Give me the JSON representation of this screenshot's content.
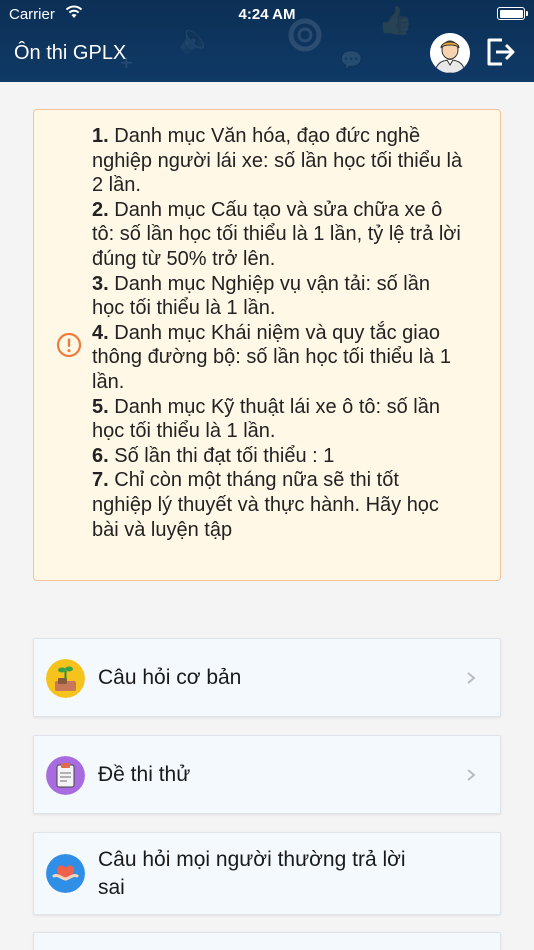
{
  "status_bar": {
    "carrier": "Carrier",
    "time": "4:24 AM"
  },
  "header": {
    "title": "Ôn thi GPLX"
  },
  "notice": {
    "items": [
      {
        "num": "1.",
        "text": " Danh mục Văn hóa, đạo đức nghề nghiệp người lái xe: số lần học tối thiểu là 2 lần."
      },
      {
        "num": "2.",
        "text": " Danh mục Cấu tạo và sửa chữa xe ô tô: số lần học tối thiểu là 1 lần, tỷ lệ trả lời đúng từ 50% trở lên."
      },
      {
        "num": "3.",
        "text": " Danh mục Nghiệp vụ vận tải: số lần học tối thiểu là 1 lần."
      },
      {
        "num": "4.",
        "text": " Danh mục Khái niệm và quy tắc giao thông đường bộ: số lần học tối thiểu là 1 lần."
      },
      {
        "num": "5.",
        "text": " Danh mục Kỹ thuật lái xe ô tô: số lần học tối thiểu là 1 lần."
      },
      {
        "num": "6.",
        "text": " Số lần thi đạt tối thiểu : 1"
      },
      {
        "num": "7.",
        "text": " Chỉ còn một tháng nữa sẽ thi tốt nghiệp lý thuyết và thực hành. Hãy học bài và luyện tập"
      }
    ]
  },
  "menu": {
    "items": [
      {
        "label": "Câu hỏi cơ bản"
      },
      {
        "label": "Đề thi thử"
      },
      {
        "label": "Câu hỏi mọi người thường trả lời sai"
      }
    ]
  },
  "colors": {
    "header_bg": "#0f3a66",
    "notice_bg": "#fff8e7",
    "notice_border": "#f2c39a",
    "warning": "#f07a3a",
    "card_bg": "#f4f9fd"
  },
  "icons": [
    "wifi-icon",
    "battery-icon",
    "avatar-icon",
    "logout-icon",
    "warning-icon",
    "plant-money-icon",
    "clipboard-icon",
    "heart-hands-icon",
    "chevron-right-icon"
  ]
}
